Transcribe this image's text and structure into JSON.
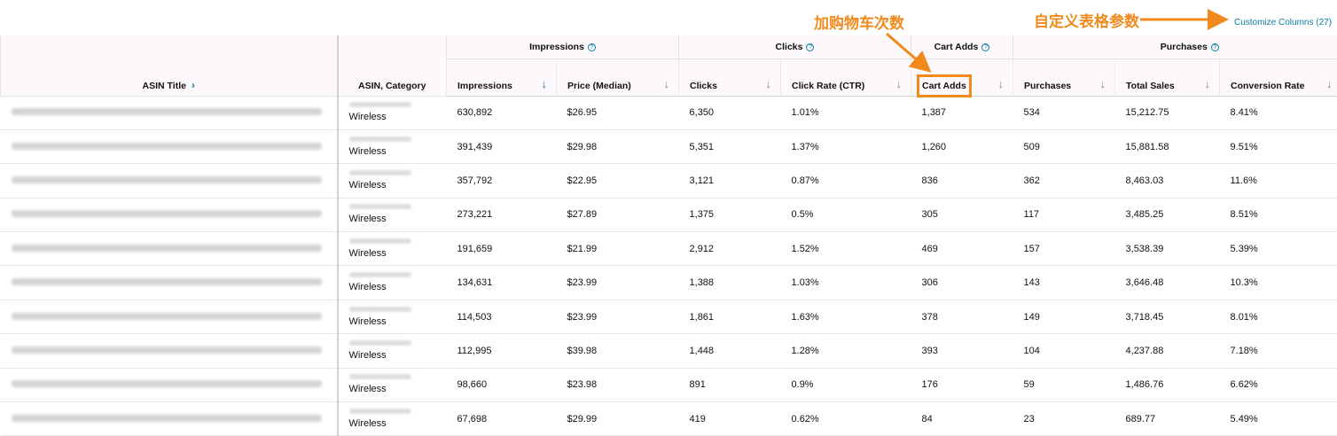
{
  "annotations": {
    "cart_adds_note": "加购物车次数",
    "customize_note": "自定义表格参数"
  },
  "customize_link": "Customize Columns (27)",
  "groups": {
    "impressions": "Impressions",
    "clicks": "Clicks",
    "cart_adds": "Cart Adds",
    "purchases": "Purchases"
  },
  "columns": {
    "asin_title": "ASIN Title",
    "asin_category": "ASIN, Category",
    "impressions": "Impressions",
    "price_median": "Price (Median)",
    "clicks": "Clicks",
    "click_rate": "Click Rate (CTR)",
    "cart_adds": "Cart Adds",
    "purchases": "Purchases",
    "total_sales": "Total Sales",
    "conversion_rate": "Conversion Rate"
  },
  "rows": [
    {
      "category": "Wireless",
      "impressions": "630,892",
      "price": "$26.95",
      "clicks": "6,350",
      "ctr": "1.01%",
      "cart_adds": "1,387",
      "purchases": "534",
      "total_sales": "15,212.75",
      "conversion": "8.41%"
    },
    {
      "category": "Wireless",
      "impressions": "391,439",
      "price": "$29.98",
      "clicks": "5,351",
      "ctr": "1.37%",
      "cart_adds": "1,260",
      "purchases": "509",
      "total_sales": "15,881.58",
      "conversion": "9.51%"
    },
    {
      "category": "Wireless",
      "impressions": "357,792",
      "price": "$22.95",
      "clicks": "3,121",
      "ctr": "0.87%",
      "cart_adds": "836",
      "purchases": "362",
      "total_sales": "8,463.03",
      "conversion": "11.6%"
    },
    {
      "category": "Wireless",
      "impressions": "273,221",
      "price": "$27.89",
      "clicks": "1,375",
      "ctr": "0.5%",
      "cart_adds": "305",
      "purchases": "117",
      "total_sales": "3,485.25",
      "conversion": "8.51%"
    },
    {
      "category": "Wireless",
      "impressions": "191,659",
      "price": "$21.99",
      "clicks": "2,912",
      "ctr": "1.52%",
      "cart_adds": "469",
      "purchases": "157",
      "total_sales": "3,538.39",
      "conversion": "5.39%"
    },
    {
      "category": "Wireless",
      "impressions": "134,631",
      "price": "$23.99",
      "clicks": "1,388",
      "ctr": "1.03%",
      "cart_adds": "306",
      "purchases": "143",
      "total_sales": "3,646.48",
      "conversion": "10.3%"
    },
    {
      "category": "Wireless",
      "impressions": "114,503",
      "price": "$23.99",
      "clicks": "1,861",
      "ctr": "1.63%",
      "cart_adds": "378",
      "purchases": "149",
      "total_sales": "3,718.45",
      "conversion": "8.01%"
    },
    {
      "category": "Wireless",
      "impressions": "112,995",
      "price": "$39.98",
      "clicks": "1,448",
      "ctr": "1.28%",
      "cart_adds": "393",
      "purchases": "104",
      "total_sales": "4,237.88",
      "conversion": "7.18%"
    },
    {
      "category": "Wireless",
      "impressions": "98,660",
      "price": "$23.98",
      "clicks": "891",
      "ctr": "0.9%",
      "cart_adds": "176",
      "purchases": "59",
      "total_sales": "1,486.76",
      "conversion": "6.62%"
    },
    {
      "category": "Wireless",
      "impressions": "67,698",
      "price": "$29.99",
      "clicks": "419",
      "ctr": "0.62%",
      "cart_adds": "84",
      "purchases": "23",
      "total_sales": "689.77",
      "conversion": "5.49%"
    }
  ],
  "colors": {
    "accent": "#0a7ea4",
    "annotation": "#f08a1c",
    "header_bg": "#fcf8fb"
  }
}
